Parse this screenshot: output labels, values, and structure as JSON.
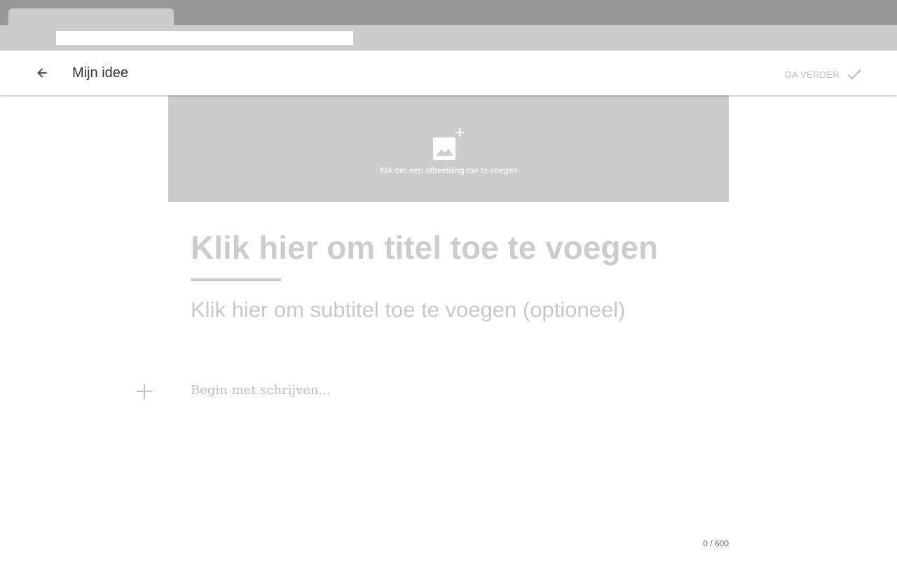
{
  "browser": {
    "tab_title": "",
    "url": ""
  },
  "header": {
    "title": "Mijn idee",
    "next_label": "GA VERDER",
    "back_icon": "arrow-left-icon",
    "check_icon": "check-icon"
  },
  "cover": {
    "hint": "Klik om een afbeelding toe te voegen",
    "icon": "add-photo-icon"
  },
  "editor": {
    "title_placeholder": "Klik hier om titel toe te voegen",
    "subtitle_placeholder": "Klik hier om subtitel toe te voegen (optioneel)",
    "body_placeholder": "Begin met schrijven...",
    "add_icon": "plus-icon",
    "char_count": "0 / 600"
  },
  "colors": {
    "placeholder": "#cccccc",
    "cover_bg": "#cccccc",
    "tabstrip": "#979797"
  }
}
